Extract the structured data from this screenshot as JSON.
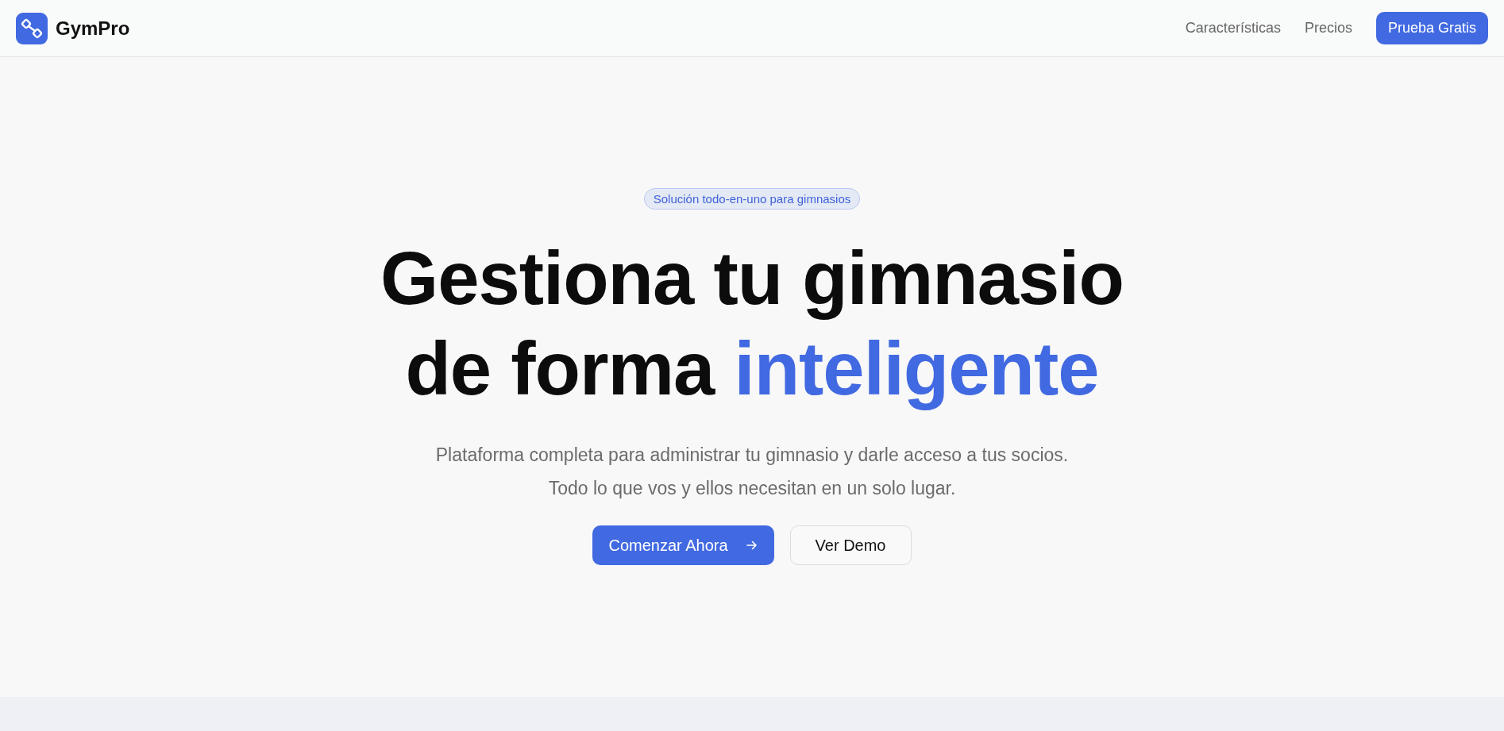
{
  "header": {
    "brand": "GymPro",
    "nav": [
      {
        "label": "Características"
      },
      {
        "label": "Precios"
      }
    ],
    "cta": "Prueba Gratis"
  },
  "hero": {
    "badge": "Solución todo-en-uno para gimnasios",
    "title": "Gestiona tu gimnasio de forma",
    "title_highlight": "inteligente",
    "subtitle": "Plataforma completa para administrar tu gimnasio y darle acceso a tus socios. Todo lo que vos y ellos necesitan en un solo lugar.",
    "primary_button": "Comenzar Ahora",
    "secondary_button": "Ver Demo"
  }
}
